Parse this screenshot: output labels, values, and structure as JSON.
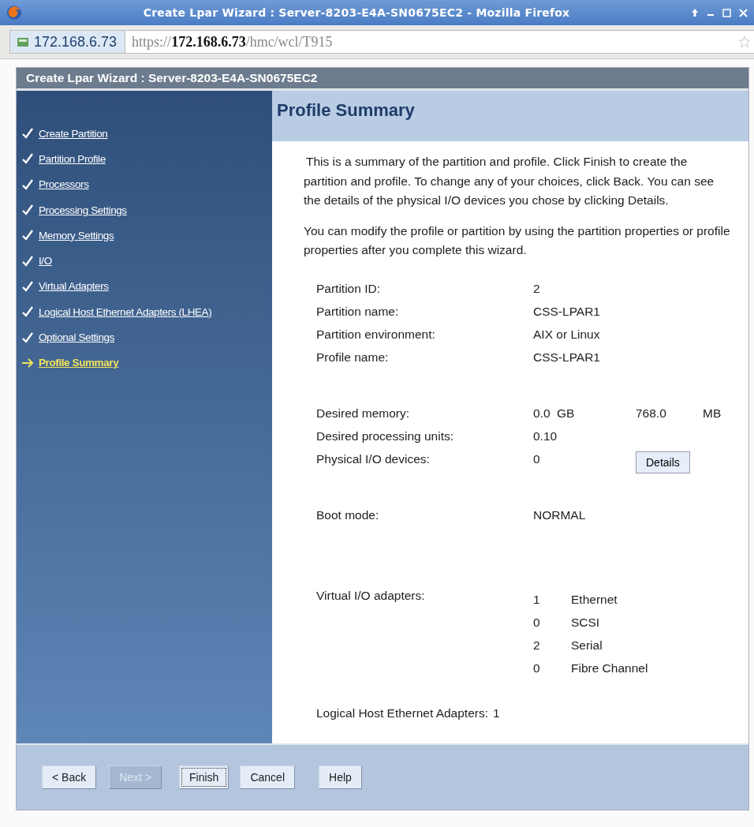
{
  "window": {
    "title": "Create Lpar Wizard : Server-8203-E4A-SN0675EC2 - Mozilla Firefox"
  },
  "address_bar": {
    "site": "172.168.6.73",
    "url": "https://**172.168.6.73**/hmc/wcl/T915"
  },
  "wizard": {
    "title": "Create Lpar Wizard : Server-8203-E4A-SN0675EC2",
    "steps": [
      {
        "label": "Create Partition",
        "selected": false
      },
      {
        "label": "Partition Profile",
        "selected": false
      },
      {
        "label": "Processors",
        "selected": false
      },
      {
        "label": "Processing Settings",
        "selected": false
      },
      {
        "label": "Memory Settings",
        "selected": false
      },
      {
        "label": "I/O",
        "selected": false
      },
      {
        "label": "Virtual Adapters",
        "selected": false
      },
      {
        "label": "Logical Host Ethernet Adapters (LHEA)",
        "selected": false
      },
      {
        "label": "Optional Settings",
        "selected": false
      },
      {
        "label": "Profile Summary",
        "selected": true
      }
    ],
    "heading": "Profile Summary",
    "paragraphs": [
      "This is a summary of the partition and profile. Click Finish to create the partition and profile. To change any of your choices, click Back. You can see the details of the physical I/O devices you chose by clicking Details.",
      "You can modify the profile or partition by using the partition properties or profile properties after you complete this wizard."
    ],
    "groups": [
      {
        "rows": [
          {
            "kind": "plain",
            "label": "Partition ID:",
            "values": [
              "2"
            ]
          },
          {
            "kind": "plain",
            "label": "Partition name:",
            "values": [
              "CSS-LPAR1"
            ]
          },
          {
            "kind": "plain",
            "label": "Partition environment:",
            "values": [
              "AIX or Linux"
            ]
          },
          {
            "kind": "plain",
            "label": "Profile name:",
            "values": [
              "CSS-LPAR1"
            ]
          }
        ]
      },
      {
        "rows": [
          {
            "kind": "plain",
            "label": "Desired memory:",
            "values": [
              "0.0",
              "GB",
              "768.0",
              "MB"
            ]
          },
          {
            "kind": "plain",
            "label": "Desired processing units:",
            "values": [
              "0.10"
            ]
          },
          {
            "kind": "button",
            "label": "Physical I/O devices:",
            "values": [
              "0"
            ],
            "button": "Details"
          }
        ]
      },
      {
        "rows": [
          {
            "kind": "plain",
            "label": "Boot mode:",
            "values": [
              "NORMAL"
            ]
          }
        ]
      },
      {
        "rows": [
          {
            "kind": "adapters",
            "label": "Virtual I/O adapters:",
            "items": [
              {
                "count": "1",
                "type": "Ethernet"
              },
              {
                "count": "0",
                "type": "SCSI"
              },
              {
                "count": "2",
                "type": "Serial"
              },
              {
                "count": "0",
                "type": "Fibre Channel"
              }
            ]
          }
        ]
      },
      {
        "rows": [
          {
            "kind": "inline",
            "label": "Logical Host Ethernet Adapters:",
            "values": [
              "1"
            ]
          }
        ]
      }
    ],
    "buttons": [
      {
        "label": "< Back",
        "disabled": false,
        "focused": false
      },
      {
        "label": "Next >",
        "disabled": true,
        "focused": false
      },
      {
        "label": "Finish",
        "disabled": false,
        "focused": true
      },
      {
        "label": "Cancel",
        "disabled": false,
        "focused": false
      },
      {
        "label": "Help",
        "disabled": false,
        "focused": false
      }
    ]
  }
}
